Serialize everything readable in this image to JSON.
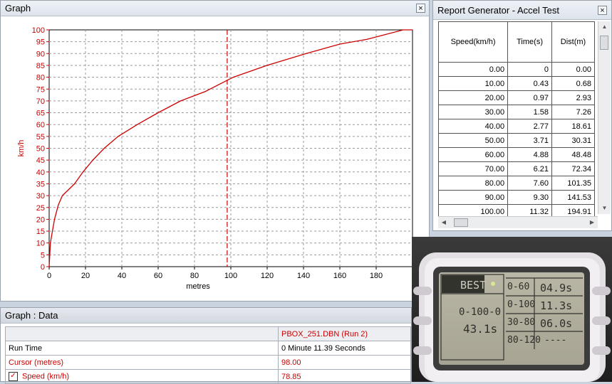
{
  "graph_window": {
    "title": "Graph",
    "close_glyph": "×"
  },
  "chart_data": {
    "type": "line",
    "xlabel": "metres",
    "ylabel": "km/h",
    "xlim": [
      0,
      200
    ],
    "ylim": [
      0,
      100
    ],
    "x_ticks": [
      0,
      20,
      40,
      60,
      80,
      100,
      120,
      140,
      160,
      180
    ],
    "y_ticks": [
      0,
      5,
      10,
      15,
      20,
      25,
      30,
      35,
      40,
      45,
      50,
      55,
      60,
      65,
      70,
      75,
      80,
      85,
      90,
      95,
      100
    ],
    "grid": true,
    "cursor_x": 98,
    "series": [
      {
        "color": "#cc0000",
        "x": [
          0,
          0.68,
          2.93,
          5,
          7.26,
          10,
          14,
          18.61,
          24,
          30.31,
          38,
          48.48,
          60,
          72.34,
          86,
          101.35,
          120,
          141.53,
          160,
          175,
          194.91,
          200
        ],
        "y": [
          0,
          10,
          20,
          26,
          30,
          32,
          35,
          40,
          45,
          50,
          55,
          60,
          65,
          70,
          74,
          80,
          85,
          90,
          94,
          96,
          100,
          100
        ]
      }
    ]
  },
  "data_window": {
    "title": "Graph : Data",
    "run_header": "PBOX_251.DBN (Run 2)",
    "rows": [
      {
        "label": "Run Time",
        "value": "0 Minute 11.39 Seconds"
      },
      {
        "label": "Cursor (metres)",
        "value": "98.00"
      },
      {
        "label": "Speed (km/h)",
        "value": "78.85",
        "check": "✓"
      }
    ]
  },
  "report_window": {
    "title": "Report Generator - Accel Test",
    "close_glyph": "×",
    "headers": [
      "Speed(km/h)",
      "Time(s)",
      "Dist(m)"
    ],
    "rows": [
      [
        "0.00",
        "0",
        "0.00"
      ],
      [
        "10.00",
        "0.43",
        "0.68"
      ],
      [
        "20.00",
        "0.97",
        "2.93"
      ],
      [
        "30.00",
        "1.58",
        "7.26"
      ],
      [
        "40.00",
        "2.77",
        "18.61"
      ],
      [
        "50.00",
        "3.71",
        "30.31"
      ],
      [
        "60.00",
        "4.88",
        "48.48"
      ],
      [
        "70.00",
        "6.21",
        "72.34"
      ],
      [
        "80.00",
        "7.60",
        "101.35"
      ],
      [
        "90.00",
        "9.30",
        "141.53"
      ],
      [
        "100.00",
        "11.32",
        "194.91"
      ]
    ],
    "scroll_up": "▲",
    "scroll_down": "▼",
    "scroll_left": "◀",
    "scroll_right": "▶"
  },
  "lcd": {
    "best_label": "BEST",
    "main_range": "0-100-0",
    "main_value": "43.1s",
    "rows": [
      {
        "range": "0-60",
        "value": "04.9s"
      },
      {
        "range": "0-100",
        "value": "11.3s"
      },
      {
        "range": "30-80",
        "value": "06.0s"
      },
      {
        "range": "80-120",
        "value": "----"
      }
    ]
  }
}
